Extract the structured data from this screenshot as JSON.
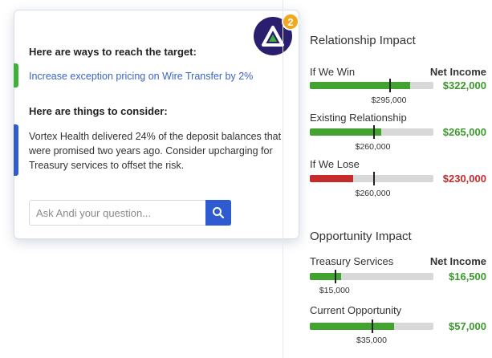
{
  "assistant": {
    "ways_heading": "Here are ways to reach the target:",
    "suggestion": "Increase exception pricing on Wire Transfer by 2%",
    "consider_heading": "Here are things to consider:",
    "consideration": "Vortex Health delivered 24% of the deposit balances that were promised two years ago. Consider upcharging for Treasury services to offset the risk.",
    "notification_count": "2",
    "input_placeholder": "Ask Andi your question...",
    "input_value": "",
    "avatar_icon": "andi-logo-icon",
    "search_icon": "search-icon",
    "colors": {
      "avatar_bg": "#2a1f6e",
      "badge": "#f2a81d",
      "accent_green": "#3db23a",
      "accent_blue": "#2f5bd1"
    }
  },
  "relationship": {
    "title": "Relationship Impact",
    "column_header": "Net Income",
    "rows": [
      {
        "label": "If We Win",
        "reference": "$295,000",
        "value": "$322,000",
        "status": "positive",
        "fill_fraction": 0.81,
        "marker_fraction": 0.64
      },
      {
        "label": "Existing Relationship",
        "reference": "$260,000",
        "value": "$265,000",
        "status": "positive",
        "fill_fraction": 0.58,
        "marker_fraction": 0.51
      },
      {
        "label": "If We Lose",
        "reference": "$260,000",
        "value": "$230,000",
        "status": "negative",
        "fill_fraction": 0.35,
        "marker_fraction": 0.51
      }
    ]
  },
  "opportunity": {
    "title": "Opportunity Impact",
    "column_header": "Net Income",
    "rows": [
      {
        "label": "Treasury Services",
        "reference": "$15,000",
        "value": "$16,500",
        "status": "positive",
        "fill_fraction": 0.25,
        "marker_fraction": 0.2
      },
      {
        "label": "Current Opportunity",
        "reference": "$35,000",
        "value": "$57,000",
        "status": "positive",
        "fill_fraction": 0.68,
        "marker_fraction": 0.5
      }
    ]
  },
  "colors": {
    "positive": "#3c9a2c",
    "negative": "#c62b2b",
    "fill_positive": "#43a330",
    "track": "#d8d8d8"
  }
}
